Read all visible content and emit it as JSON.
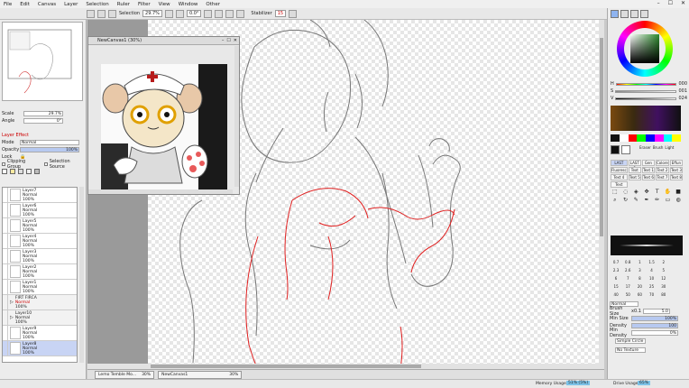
{
  "menu": [
    "File",
    "Edit",
    "Canvas",
    "Layer",
    "Selection",
    "Ruler",
    "Filter",
    "View",
    "Window",
    "Other"
  ],
  "window_controls": [
    "–",
    "☐",
    "✕"
  ],
  "toolbar": {
    "selection_label": "Selection",
    "zoom": "29.7%",
    "angle": "0.0°",
    "stabilizer_label": "Stabilizer",
    "stabilizer_value": "15"
  },
  "left": {
    "scale_label": "Scale",
    "scale_value": "29.7%",
    "angle_label": "Angle",
    "angle_value": "0°",
    "layer_effect": "Layer Effect",
    "mode_label": "Mode",
    "mode_value": "Normal",
    "opacity_label": "Opacity",
    "opacity_value": "100%",
    "lock_label": "Lock",
    "clipping_group": "Clipping Group",
    "selection_source": "Selection Source",
    "layers": [
      {
        "name": "Layer7",
        "mode": "Normal",
        "opacity": "100%"
      },
      {
        "name": "Layer6",
        "mode": "Normal",
        "opacity": "100%"
      },
      {
        "name": "Layer5",
        "mode": "Normal",
        "opacity": "100%"
      },
      {
        "name": "Layer4",
        "mode": "Normal",
        "opacity": "100%"
      },
      {
        "name": "Layer3",
        "mode": "Normal",
        "opacity": "100%"
      },
      {
        "name": "Layer2",
        "mode": "Normal",
        "opacity": "100%"
      },
      {
        "name": "Layer1",
        "mode": "Normal",
        "opacity": "100%"
      },
      {
        "name": "FIRT FIRCA",
        "mode": "Normal",
        "opacity": "100%"
      },
      {
        "name": "Layer10",
        "mode": "Normal",
        "opacity": "100%"
      },
      {
        "name": "Layer9",
        "mode": "Normal",
        "opacity": "100%"
      },
      {
        "name": "Layer8",
        "mode": "Normal",
        "opacity": "100%"
      }
    ]
  },
  "subwindow": {
    "title": "NewCanvas1 (30%)"
  },
  "status": {
    "tab1_name": "Lemo Temble Mo...",
    "tab1_zoom": "30%",
    "tab2_name": "NewCanvas1",
    "tab2_zoom": "30%",
    "memory_label": "Memory Usage",
    "memory_value": "51% (5%)",
    "drive_label": "Drive Usage",
    "drive_value": "65%"
  },
  "right": {
    "h_label": "H",
    "h_value": "000",
    "s_label": "S",
    "s_value": "001",
    "v_label": "V",
    "v_value": "024",
    "tool_tabs": [
      "LAST",
      "LAST 2",
      "Gen",
      "Colore",
      "Effun"
    ],
    "tool_row2": [
      "Fluoresc",
      "Text",
      "Text 1",
      "Text 2",
      "Text 3"
    ],
    "tool_row3": [
      "Text 4",
      "Text 5",
      "Text 6",
      "Text 7",
      "Text 8"
    ],
    "tool_row4": [
      "Text"
    ],
    "brush_names": [
      "Eraser",
      "Brush",
      "Light"
    ],
    "sizes": [
      "0.7",
      "0.8",
      "1",
      "1.5",
      "2",
      "",
      "2.3",
      "2.6",
      "3",
      "4",
      "5",
      "",
      "6",
      "7",
      "8",
      "10",
      "12",
      "",
      "15",
      "17",
      "20",
      "25",
      "30",
      "",
      "40",
      "50",
      "60",
      "70",
      "80",
      ""
    ],
    "blend_mode": "Normal",
    "brush_size_label": "Brush Size",
    "brush_size_mult": "x0.1",
    "brush_size_value": "5.0",
    "min_size_label": "Min Size",
    "min_size_value": "100%",
    "density_label": "Density",
    "density_value": "100",
    "min_density_label": "Min Density",
    "min_density_value": "0%",
    "simple_circle": "Simple Circle",
    "no_texture": "No Texture"
  },
  "colors": {
    "accent_select": "#c8d4f4",
    "fg_color": "#101010",
    "bg_color": "#ffffff",
    "red_line": "#e02020"
  }
}
